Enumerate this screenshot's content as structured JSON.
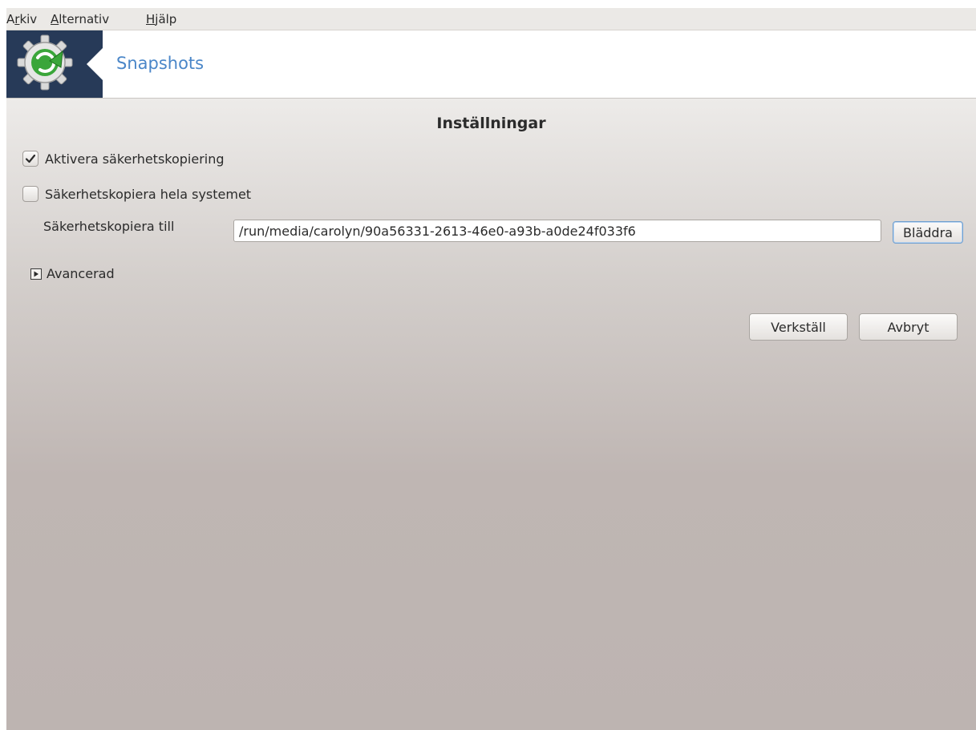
{
  "menu": [
    {
      "prefix": "A",
      "mnemonic": "r",
      "suffix": "kiv"
    },
    {
      "prefix": "",
      "mnemonic": "A",
      "suffix": "lternativ"
    },
    {
      "prefix": "",
      "mnemonic": "H",
      "suffix": "jälp"
    }
  ],
  "header": {
    "app_title": "Snapshots",
    "logo_icon": "gear-refresh-icon"
  },
  "settings": {
    "section_title": "Inställningar",
    "enable_backup": {
      "label": "Aktivera säkerhetskopiering",
      "checked": true
    },
    "backup_whole_system": {
      "label": "Säkerhetskopiera hela systemet",
      "checked": false
    },
    "backup_to": {
      "label": "Säkerhetskopiera till",
      "value": "/run/media/carolyn/90a56331-2613-46e0-a93b-a0de24f033f6"
    },
    "browse_label": "Bläddra",
    "advanced_label": "Avancerad",
    "advanced_icon": "triangle-right-icon"
  },
  "actions": {
    "apply_label": "Verkställ",
    "cancel_label": "Avbryt"
  },
  "colors": {
    "logo_bg": "#273a58",
    "title_blue": "#4a86c8",
    "gear_green": "#3aa63a"
  }
}
